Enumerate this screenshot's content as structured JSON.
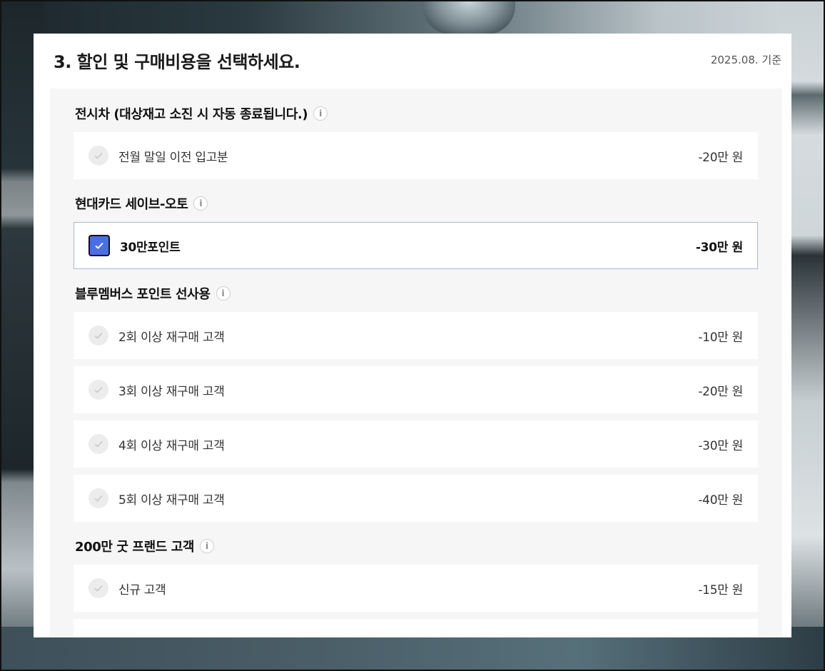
{
  "header": {
    "title": "3. 할인 및 구매비용을 선택하세요.",
    "date": "2025.08. 기준"
  },
  "sections": [
    {
      "title": "전시차 (대상재고 소진 시 자동 종료됩니다.)",
      "options": [
        {
          "label": "전월 말일 이전 입고분",
          "price": "-20만 원",
          "selected": false
        }
      ]
    },
    {
      "title": "현대카드 세이브-오토",
      "options": [
        {
          "label": "30만포인트",
          "price": "-30만 원",
          "selected": true
        }
      ]
    },
    {
      "title": "블루멤버스 포인트 선사용",
      "options": [
        {
          "label": "2회 이상 재구매 고객",
          "price": "-10만 원",
          "selected": false
        },
        {
          "label": "3회 이상 재구매 고객",
          "price": "-20만 원",
          "selected": false
        },
        {
          "label": "4회 이상 재구매 고객",
          "price": "-30만 원",
          "selected": false
        },
        {
          "label": "5회 이상 재구매 고객",
          "price": "-40만 원",
          "selected": false
        }
      ]
    },
    {
      "title": "200만 굿 프랜드 고객",
      "options": [
        {
          "label": "신규 고객",
          "price": "-15만 원",
          "selected": false
        },
        {
          "label": "",
          "price": "",
          "selected": false
        }
      ]
    }
  ],
  "icons": {
    "info": "i",
    "check": "check-icon"
  },
  "colors": {
    "accent": "#4a6fe3",
    "selected_border": "#a8b9cc",
    "content_bg": "#f6f6f6"
  }
}
